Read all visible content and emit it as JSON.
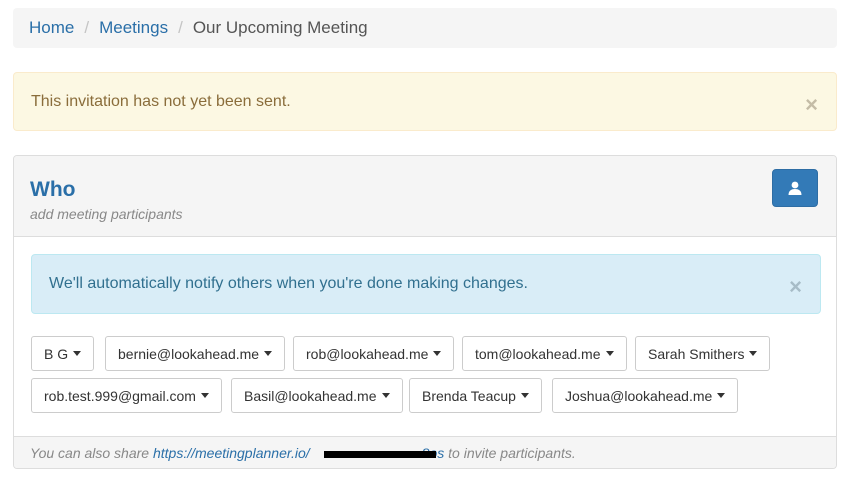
{
  "breadcrumb": {
    "home": "Home",
    "meetings": "Meetings",
    "current": "Our Upcoming Meeting",
    "separator": "/"
  },
  "warning_alert": {
    "text": "This invitation has not yet been sent.",
    "close": "×"
  },
  "panel": {
    "title": "Who",
    "subtitle": "add meeting participants",
    "add_button_icon": "user-icon"
  },
  "info_alert": {
    "text": "We'll automatically notify others when you're done making changes.",
    "close": "×"
  },
  "participants": [
    {
      "label": "B G"
    },
    {
      "label": "bernie@lookahead.me"
    },
    {
      "label": "rob@lookahead.me"
    },
    {
      "label": "tom@lookahead.me"
    },
    {
      "label": "Sarah Smithers"
    },
    {
      "label": "rob.test.999@gmail.com"
    },
    {
      "label": "Basil@lookahead.me"
    },
    {
      "label": "Brenda Teacup"
    },
    {
      "label": "Joshua@lookahead.me"
    }
  ],
  "footer": {
    "prefix": "You can also share",
    "link": "https://meetingplanner.io/",
    "link_tail": "8os",
    "suffix": "to invite participants."
  },
  "colors": {
    "link": "#2a6fa8",
    "primary_button": "#337ab7",
    "warning_bg": "#fcf8e3",
    "info_bg": "#d9edf7"
  }
}
